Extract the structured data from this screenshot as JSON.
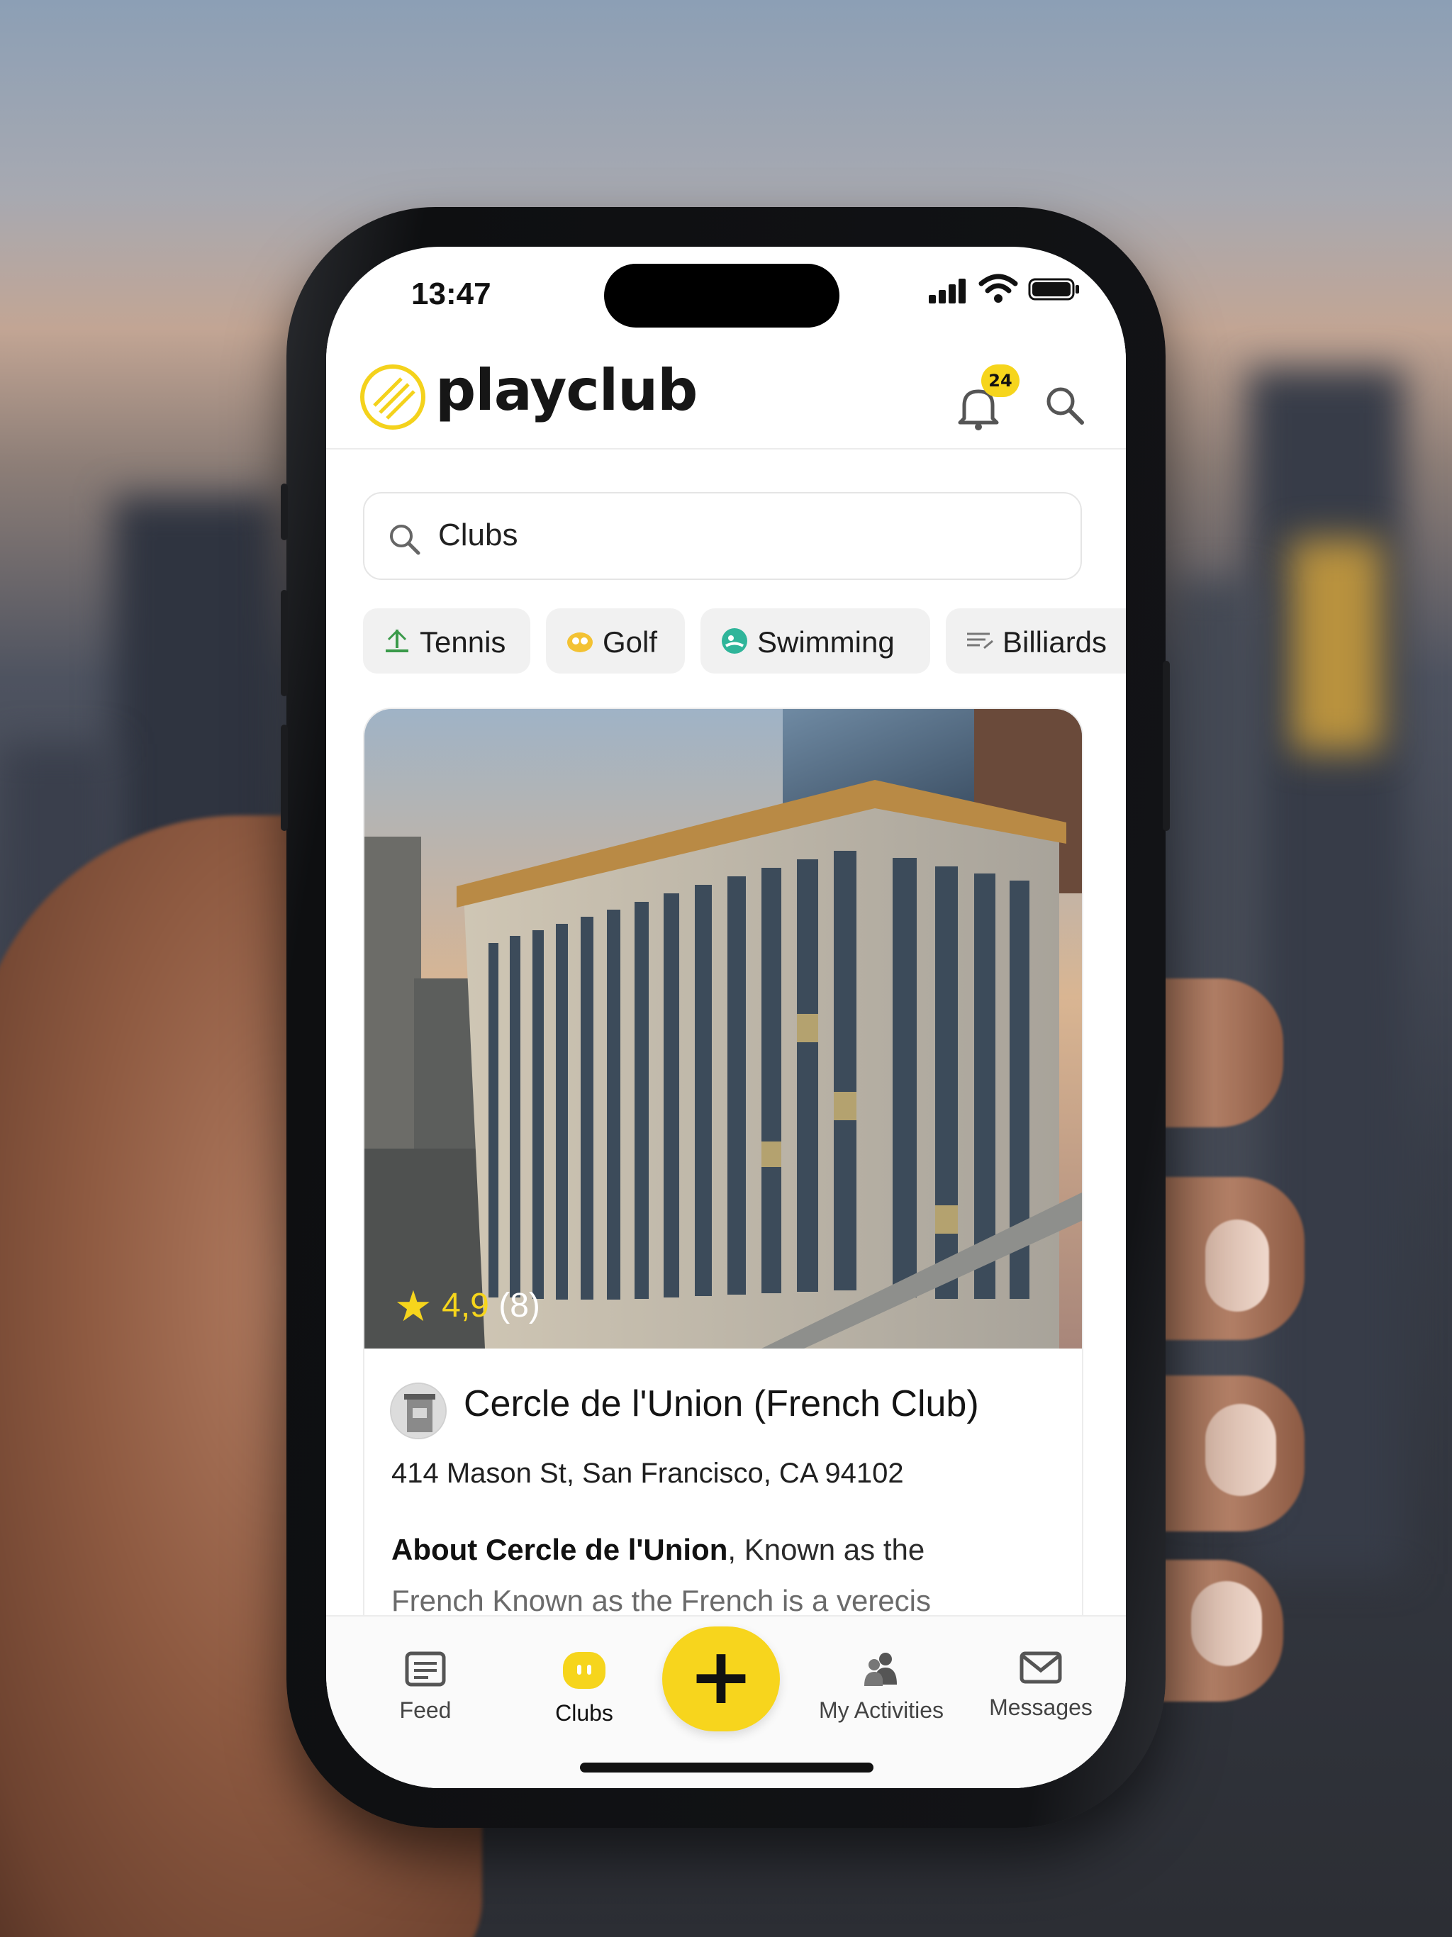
{
  "status_bar": {
    "time": "13:47"
  },
  "header": {
    "brand": "playclub",
    "notification_count": "24"
  },
  "search": {
    "value": "Clubs"
  },
  "chips": [
    {
      "label": "Tennis",
      "icon": "tennis-icon"
    },
    {
      "label": "Golf",
      "icon": "golf-icon"
    },
    {
      "label": "Swimming",
      "icon": "swimming-icon"
    },
    {
      "label": "Billiards",
      "icon": "billiards-icon"
    }
  ],
  "club": {
    "rating": "4,9",
    "reviews": "(8)",
    "name": "Cercle de l'Union (French Club)",
    "address": "414 Mason St, San Francisco, CA 94102",
    "about_title": "About Cercle de l'Union",
    "about_line1": ", Known as the",
    "about_line2": "French Known as the French is a verecis"
  },
  "nav": {
    "feed": "Feed",
    "clubs": "Clubs",
    "activities": "My Activities",
    "messages": "Messages"
  },
  "colors": {
    "accent": "#f6d51c",
    "text": "#141414",
    "muted": "#6b6b6b"
  }
}
